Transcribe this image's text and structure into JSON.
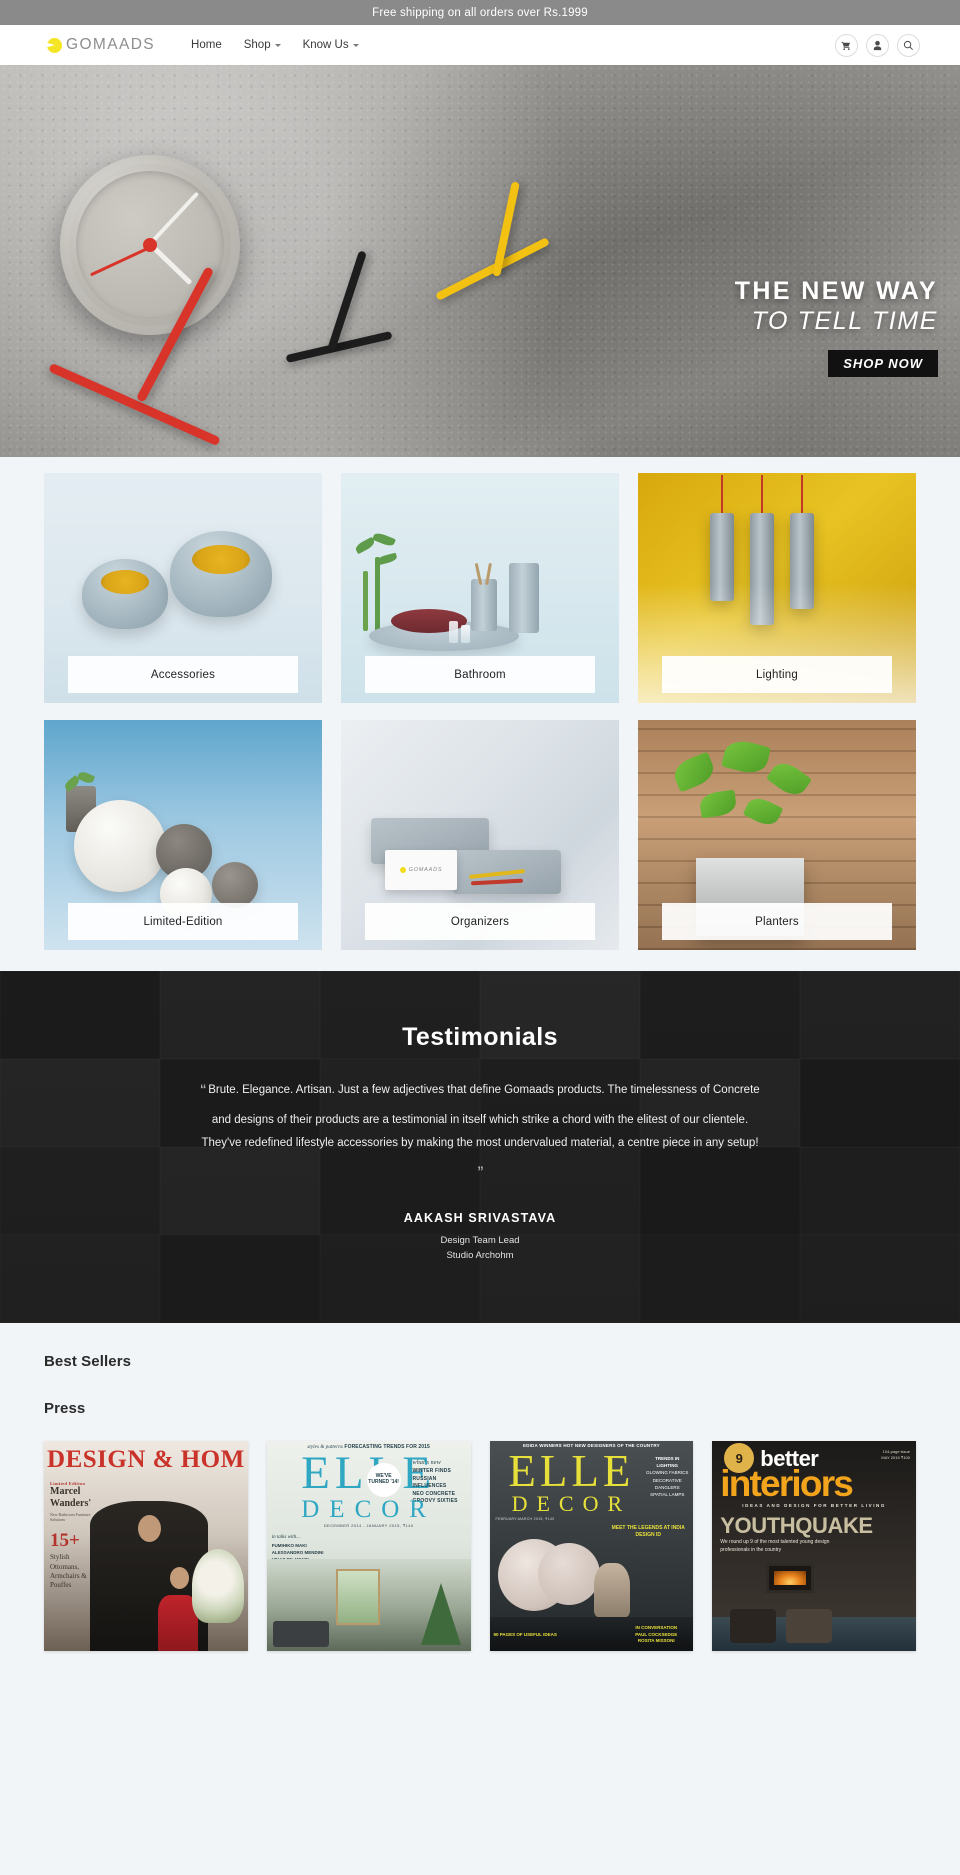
{
  "announcement": {
    "text": "Free shipping on all orders over Rs.1999"
  },
  "header": {
    "logo_text": "GOMAADS",
    "nav": [
      {
        "label": "Home",
        "has_caret": false
      },
      {
        "label": "Shop",
        "has_caret": true
      },
      {
        "label": "Know Us",
        "has_caret": true
      }
    ],
    "actions": [
      {
        "name": "cart-icon",
        "label": "Cart"
      },
      {
        "name": "account-icon",
        "label": "Account"
      },
      {
        "name": "search-icon",
        "label": "Search"
      }
    ]
  },
  "hero": {
    "line1": "THE NEW WAY",
    "line2": "TO TELL TIME",
    "cta": "SHOP NOW"
  },
  "categories": [
    {
      "label": "Accessories"
    },
    {
      "label": "Bathroom"
    },
    {
      "label": "Lighting"
    },
    {
      "label": "Limited-Edition"
    },
    {
      "label": "Organizers"
    },
    {
      "label": "Planters"
    }
  ],
  "testimonials": {
    "title": "Testimonials",
    "quote_open": "“",
    "quote_close": "”",
    "line1": "Brute. Elegance. Artisan. Just a few adjectives that define Gomaads products.",
    "line2": "The timelessness of Concrete and designs of their products are a testimonial in itself which strike a chord with the",
    "line3": "elitest of our clientele. They've redefined lifestyle accessories by making the most undervalued material, a",
    "line4": "centre piece in any setup!",
    "author": "AAKASH SRIVASTAVA",
    "role_line1": "Design Team Lead",
    "role_line2": "Studio Archohm"
  },
  "best_sellers": {
    "title": "Best Sellers"
  },
  "press": {
    "title": "Press",
    "covers": [
      {
        "name": "design-and-home",
        "title": "DESIGN & HOM",
        "kicker": "Limited Edition",
        "name_line": "Marcel Wanders'",
        "sub": "New Bathroom Furniture Solutions",
        "big": "15+",
        "list": "Stylish Ottomans, Armchairs & Pouffes"
      },
      {
        "name": "elle-decor-2015",
        "top_italic": "styles & patterns",
        "top_bold": "FORECASTING TRENDS FOR 2015",
        "masthead": "ELLE",
        "submast": "DECOR",
        "date": "DECEMBER 2014 - JANUARY 2015, ₹140",
        "badge": "WE'VE TURNED '14!",
        "right_head": "what's new",
        "right_items": "WINTER FINDS\nRUSSIAN INFLUENCES\nNEO CONCRETE\nGROOVY SIXTIES",
        "left_head": "in talks with...",
        "left_items": "FUMIHIKO MAKI\nALESSANDRO MENDINI\nVIKAS DILAWARI\nSANJEEV PANJABI\n& SANGEETA MERCHANT"
      },
      {
        "name": "elle-decor-design-id",
        "top": "EDIDA WINNERS  HOT NEW DESIGNERS OF THE COUNTRY",
        "masthead": "ELLE",
        "submast": "DECOR",
        "right_head": "TRENDS IN LIGHTING",
        "right_items": "GLOWING FABRICS\nDECORATIVE DANGLERS\nSPATIAL LAMPS",
        "date": "FEBRUARY-MARCH 2015, ₹140",
        "mid": "MEET THE LEGENDS AT INDIA DESIGN ID",
        "bottom_left": "90 PAGES OF USEFUL IDEAS",
        "bottom_right": "IN CONVERSATION\nPAUL COCKSEDGE\nROSITA MISSONI"
      },
      {
        "name": "better-interiors",
        "badge": "9",
        "brand_top": "better",
        "brand_main": "interiors",
        "tagline": "IDEAS AND DESIGN FOR BETTER LIVING",
        "headline": "YOUTHQUAKE",
        "description": "We round up 9 of the most talented young design professionals in the country",
        "price": "104-page issue\nMAY 2015   ₹100"
      }
    ]
  },
  "colors": {
    "accent_yellow": "#f5e625",
    "announcement_bg": "#8a8a8a",
    "page_bg": "#f2f5f7",
    "dark": "#262626"
  }
}
